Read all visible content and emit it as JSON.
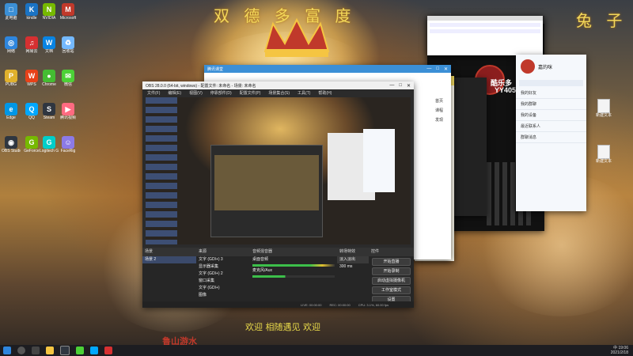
{
  "wallpaper": {
    "top_text_left": "双  德  多  富  度",
    "top_text_right": "兔  子",
    "caption_bottom_left": "鲁山游水",
    "caption_bottom_center": "欢迎  相随遇见  欢迎"
  },
  "desktop_icons": [
    {
      "label": "此电脑",
      "color": "#3b8fd6",
      "glyph": "□",
      "icon": "computer-icon"
    },
    {
      "label": "kindle",
      "color": "#1a73c4",
      "glyph": "K",
      "icon": "kindle-icon"
    },
    {
      "label": "NVIDIA",
      "color": "#76b900",
      "glyph": "N",
      "icon": "nvidia-icon"
    },
    {
      "label": "Microsoft",
      "color": "#c0392b",
      "glyph": "M",
      "icon": "app-icon"
    },
    {
      "label": "网络",
      "color": "#2e86de",
      "glyph": "◎",
      "icon": "network-icon"
    },
    {
      "label": "网易云",
      "color": "#d63031",
      "glyph": "♫",
      "icon": "music-icon"
    },
    {
      "label": "文档",
      "color": "#0984e3",
      "glyph": "W",
      "icon": "word-icon"
    },
    {
      "label": "回收站",
      "color": "#74b9ff",
      "glyph": "♻",
      "icon": "recycle-bin-icon"
    },
    {
      "label": "PUBG",
      "color": "#e1b12c",
      "glyph": "P",
      "icon": "pubg-icon"
    },
    {
      "label": "WPS",
      "color": "#e84118",
      "glyph": "W",
      "icon": "wps-icon"
    },
    {
      "label": "Chrome",
      "color": "#44bd32",
      "glyph": "●",
      "icon": "chrome-icon"
    },
    {
      "label": "微信",
      "color": "#4cd137",
      "glyph": "✉",
      "icon": "wechat-icon"
    },
    {
      "label": "Edge",
      "color": "#0097e6",
      "glyph": "e",
      "icon": "edge-icon"
    },
    {
      "label": "QQ",
      "color": "#00a8ff",
      "glyph": "Q",
      "icon": "qq-icon"
    },
    {
      "label": "Steam",
      "color": "#2f3640",
      "glyph": "S",
      "icon": "steam-icon"
    },
    {
      "label": "腾讯视频",
      "color": "#ff6b81",
      "glyph": "▶",
      "icon": "video-icon"
    },
    {
      "label": "OBS Studio",
      "color": "#2f3640",
      "glyph": "◉",
      "icon": "obs-icon"
    },
    {
      "label": "GeForce",
      "color": "#76b900",
      "glyph": "G",
      "icon": "geforce-icon"
    },
    {
      "label": "Logitech G",
      "color": "#00cec9",
      "glyph": "G",
      "icon": "logitech-icon"
    },
    {
      "label": "FaceRig",
      "color": "#8c7ae6",
      "glyph": "☺",
      "icon": "facerig-icon"
    }
  ],
  "right_desktop_icons": [
    {
      "label": "新建文本",
      "icon": "text-file-icon"
    },
    {
      "label": "新建文本",
      "icon": "text-file-icon"
    }
  ],
  "obs": {
    "title": "OBS 28.0.0 (64-bit, windows) - 配置文件: 未命名 - 场景: 未命名",
    "menu": [
      "文件(F)",
      "编辑(E)",
      "视图(V)",
      "停靠部件(D)",
      "配置文件(P)",
      "场景集合(S)",
      "工具(T)",
      "帮助(H)"
    ],
    "panels": {
      "scenes_header": "场景",
      "sources_header": "来源",
      "mixer_header": "音频混音器",
      "transitions_header": "转场特效",
      "controls_header": "控件"
    },
    "scenes": [
      "场景 2"
    ],
    "sources": [
      "文字 (GDI+) 3",
      "显示器采集",
      "文字 (GDI+) 2",
      "窗口采集",
      "文字 (GDI+)",
      "图像"
    ],
    "mixer_channels": [
      "桌面音频",
      "麦克风/Aux"
    ],
    "transition": "淡入淡出",
    "duration": "300 ms",
    "controls": [
      "开始直播",
      "开始录制",
      "启动虚拟摄像机",
      "工作室模式",
      "设置",
      "退出"
    ],
    "status": [
      "LIVE: 00:00:00",
      "REC: 00:00:00",
      "CPU: 3.1%, 60.00 fps"
    ]
  },
  "browser": {
    "title": "腾讯课堂",
    "side_items": [
      "首页",
      "课程",
      "发现"
    ]
  },
  "music": {
    "title": "酷乐多",
    "subtitle": "YY405"
  },
  "qq": {
    "name": "嘉的咪",
    "items": [
      "我的好友",
      "我的群聊",
      "我的设备",
      "最近联系人",
      "群聊消息"
    ]
  },
  "taskbar": {
    "time": "19:06",
    "date": "2021/2/18",
    "lang": "中"
  }
}
